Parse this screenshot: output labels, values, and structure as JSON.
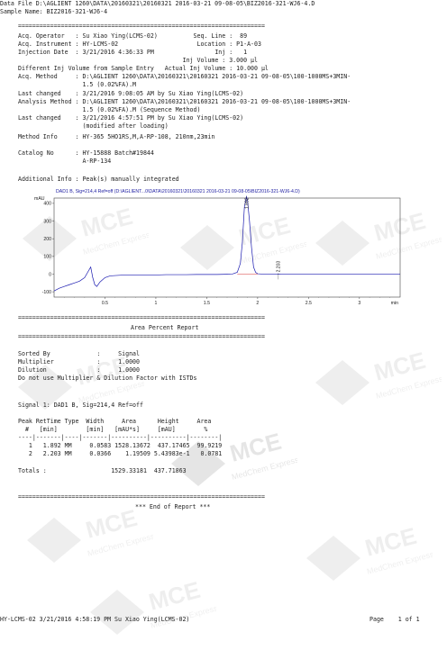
{
  "header": {
    "data_file": "Data File D:\\AGLIENT 1260\\DATA\\20160321\\20160321 2016-03-21 09-08-05\\BIZ2016-321-WJ6-4.D",
    "sample_name": "Sample Name: BIZ2016-321-WJ6-4"
  },
  "sep_eq": "=====================================================================",
  "info_lines": [
    "Acq. Operator   : Su Xiao Ying(LCMS-02)          Seq. Line :  89",
    "Acq. Instrument : HY-LCMS-02                      Location : P1-A-03",
    "Injection Date  : 3/21/2016 4:36:33 PM                 Inj :   1",
    "                                              Inj Volume : 3.000 µl",
    "Different Inj Volume from Sample Entry   Actual Inj Volume : 10.000 µl",
    "Acq. Method     : D:\\AGLIENT 1260\\DATA\\20160321\\20160321 2016-03-21 09-08-05\\100-1000MS+3MIN-",
    "                  1.5 (0.02%FA).M",
    "Last changed    : 3/21/2016 9:08:05 AM by Su Xiao Ying(LCMS-02)",
    "Analysis Method : D:\\AGLIENT 1260\\DATA\\20160321\\20160321 2016-03-21 09-08-05\\100-1000MS+3MIN-",
    "                  1.5 (0.02%FA).M (Sequence Method)",
    "Last changed    : 3/21/2016 4:57:51 PM by Su Xiao Ying(LCMS-02)",
    "                  (modified after loading)",
    "Method Info     : HY-365 5HO1RS,M,A-RP-108, 210nm,23min"
  ],
  "catalog_lines": [
    "Catalog No      : HY-15888 Batch#19844",
    "                  A-RP-134"
  ],
  "additional_info": "Additional Info : Peak(s) manually integrated",
  "chart_data": {
    "type": "line",
    "title": "DAD1 B, Sig=214,4 Ref=off (D:\\AGLIENT...0\\DATA\\20160321\\20160321 2016-03-21 09-08-05\\BIZ2016-321-WJ6-4.D)",
    "ylabel": "mAU",
    "xlabel": "min",
    "xlim": [
      0.0,
      3.4
    ],
    "ylim": [
      -130,
      430
    ],
    "xticks": [
      0.5,
      1,
      1.5,
      2,
      2.5,
      3
    ],
    "xtick_labels": [
      "0.5",
      "1",
      "1.5",
      "2",
      "2.5",
      "3"
    ],
    "yticks": [
      -100,
      0,
      100,
      200,
      300,
      400
    ],
    "ytick_labels": [
      "-100",
      "0",
      "100",
      "200",
      "300",
      "400"
    ],
    "peak_labels": [
      {
        "x": 1.892,
        "y": 437.17,
        "text": "1.892"
      },
      {
        "x": 2.203,
        "y": 0.54,
        "text": "2.203"
      }
    ],
    "series": [
      {
        "x": [
          0.0,
          0.05,
          0.1,
          0.15,
          0.2,
          0.25,
          0.3,
          0.33,
          0.36,
          0.38,
          0.4,
          0.42,
          0.45,
          0.48,
          0.5,
          0.55,
          0.6,
          0.7,
          0.8,
          0.9,
          1.0,
          1.1,
          1.2,
          1.3,
          1.4,
          1.5,
          1.6,
          1.7,
          1.75,
          1.8,
          1.83,
          1.85,
          1.87,
          1.89,
          1.9,
          1.92,
          1.94,
          1.96,
          1.98,
          2.0,
          2.05,
          2.1,
          2.15,
          2.19,
          2.2,
          2.21,
          2.23,
          2.3,
          2.4,
          2.5,
          2.6,
          2.7,
          2.8,
          2.9,
          3.0,
          3.1,
          3.2,
          3.3,
          3.4
        ],
        "y": [
          -95,
          -80,
          -70,
          -60,
          -50,
          -40,
          -20,
          10,
          40,
          -20,
          -60,
          -70,
          -45,
          -30,
          -20,
          -10,
          -8,
          -5,
          -5,
          -5,
          -5,
          -3,
          -3,
          -3,
          -2,
          -2,
          -2,
          -1,
          0,
          10,
          60,
          180,
          380,
          437,
          420,
          300,
          150,
          40,
          10,
          2,
          0,
          0,
          0,
          0,
          0.5,
          0.5,
          0,
          0,
          0,
          0,
          0,
          0,
          0,
          0,
          0,
          0,
          0,
          0,
          0
        ]
      }
    ]
  },
  "report_title": "Area Percent Report",
  "settings_lines": [
    "Sorted By             :     Signal",
    "Multiplier            :     1.0000",
    "Dilution              :     1.0000",
    "Do not use Multiplier & Dilution Factor with ISTDs"
  ],
  "signal_title": "Signal 1: DAD1 B, Sig=214,4 Ref=off",
  "table_header_lines": [
    "Peak RetTime Type  Width     Area      Height     Area",
    "  #   [min]        [min]   [mAU*s]     [mAU]        %",
    "----|-------|----|-------|----------|----------|--------|"
  ],
  "table_rows": [
    "   1   1.892 MM     0.0583 1528.13672  437.17465  99.9219",
    "   2   2.203 MM     0.0366    1.19509 5.43983e-1   0.0781"
  ],
  "totals_line": "Totals :                  1529.33181  437.71863",
  "end_of_report": "*** End of Report ***",
  "footer": {
    "left": "HY-LCMS-02 3/21/2016 4:58:19 PM Su Xiao Ying(LCMS-02)",
    "right": "Page    1 of 1"
  },
  "watermark": {
    "brand": "MCE",
    "tagline": "MedChem Express"
  }
}
